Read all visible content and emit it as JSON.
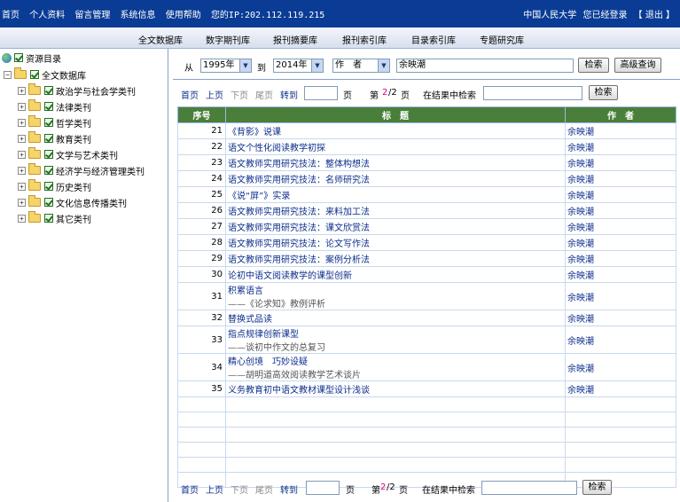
{
  "topnav": {
    "items": [
      "首页",
      "个人资料",
      "留言管理",
      "系统信息",
      "使用帮助"
    ],
    "ip": "您的IP:202.112.119.215",
    "org": "中国人民大学",
    "login_status": "您已经登录",
    "logout": "【 退出 】"
  },
  "tabs": [
    "全文数据库",
    "数字期刊库",
    "报刊摘要库",
    "报刊索引库",
    "目录索引库",
    "专题研究库"
  ],
  "sidebar": {
    "root": "资源目录",
    "db": "全文数据库",
    "categories": [
      "政治学与社会学类刊",
      "法律类刊",
      "哲学类刊",
      "教育类刊",
      "文学与艺术类刊",
      "经济学与经济管理类刊",
      "历史类刊",
      "文化信息传播类刊",
      "其它类刊"
    ]
  },
  "search": {
    "from_label": "从",
    "from_year": "1995年",
    "to_label": "到",
    "to_year": "2014年",
    "field": "作　者",
    "query": "余映潮",
    "search_button": "检索",
    "advanced_button": "高级查询"
  },
  "pager": {
    "first": "首页",
    "prev": "上页",
    "next": "下页",
    "last": "尾页",
    "goto": "转到",
    "page_unit": "页",
    "page_prefix": "第",
    "current_page": "2",
    "total_pages": "/2",
    "page_suffix": "页",
    "within_label": "在结果中检索",
    "within_button": "检索"
  },
  "table": {
    "headers": [
      "序号",
      "标　题",
      "作　者"
    ],
    "rows": [
      {
        "num": "21",
        "title": "《背影》说课",
        "sub": "",
        "author": "余映潮"
      },
      {
        "num": "22",
        "title": "语文个性化阅读教学初探",
        "sub": "",
        "author": "余映潮"
      },
      {
        "num": "23",
        "title": "语文教师实用研究技法：整体构想法",
        "sub": "",
        "author": "余映潮"
      },
      {
        "num": "24",
        "title": "语文教师实用研究技法：名师研究法",
        "sub": "",
        "author": "余映潮"
      },
      {
        "num": "25",
        "title": "《说“屏”》实录",
        "sub": "",
        "author": "余映潮"
      },
      {
        "num": "26",
        "title": "语文教师实用研究技法：来料加工法",
        "sub": "",
        "author": "余映潮"
      },
      {
        "num": "27",
        "title": "语文教师实用研究技法：课文欣赏法",
        "sub": "",
        "author": "余映潮"
      },
      {
        "num": "28",
        "title": "语文教师实用研究技法：论文写作法",
        "sub": "",
        "author": "余映潮"
      },
      {
        "num": "29",
        "title": "语文教师实用研究技法：案例分析法",
        "sub": "",
        "author": "余映潮"
      },
      {
        "num": "30",
        "title": "论初中语文阅读教学的课型创新",
        "sub": "",
        "author": "余映潮"
      },
      {
        "num": "31",
        "title": "积累语言",
        "sub": "——《论求知》教例评析",
        "author": "余映潮"
      },
      {
        "num": "32",
        "title": "替换式品读",
        "sub": "",
        "author": "余映潮"
      },
      {
        "num": "33",
        "title": "指点规律创新课型",
        "sub": "——谈初中作文的总复习",
        "author": "余映潮"
      },
      {
        "num": "34",
        "title": "精心创境　巧妙设疑",
        "sub": "——胡明道高效阅读教学艺术谈片",
        "author": "余映潮"
      },
      {
        "num": "35",
        "title": "义务教育初中语文教材课型设计浅谈",
        "sub": "",
        "author": "余映潮"
      }
    ]
  }
}
